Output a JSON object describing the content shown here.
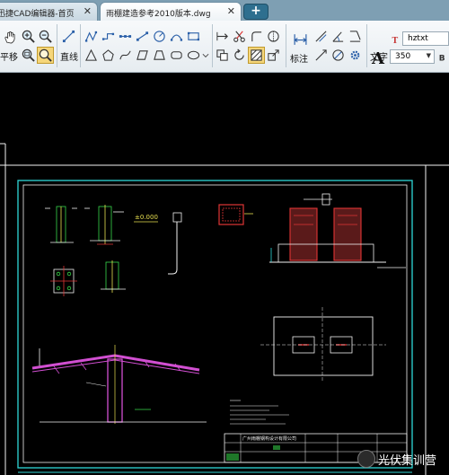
{
  "tabs": [
    {
      "label": "迅捷CAD编辑器-首页"
    },
    {
      "label": "雨棚建造参考2010版本.dwg"
    }
  ],
  "new_tab_glyph": "+",
  "toolbar": {
    "pan_label": "平移",
    "line_label": "直线",
    "annotate_label": "标注",
    "text_label": "文字",
    "font_value": "hztxt",
    "font_size_value": "350"
  },
  "drawing": {
    "title_block_company": "广州雨棚钢构设计有限公司",
    "elevation_mark": "±0.000"
  },
  "watermark": {
    "text": "光伏集训营"
  },
  "colors": {
    "canvas_bg": "#000000",
    "frame": "#2fd7d7",
    "drawing_white": "#f2f2f2",
    "steel_red": "#e03535",
    "roof_magenta": "#d24fd2",
    "structure_green": "#38d84a",
    "tab_bar": "#7e9fb3",
    "new_tab": "#2e6f8f"
  }
}
